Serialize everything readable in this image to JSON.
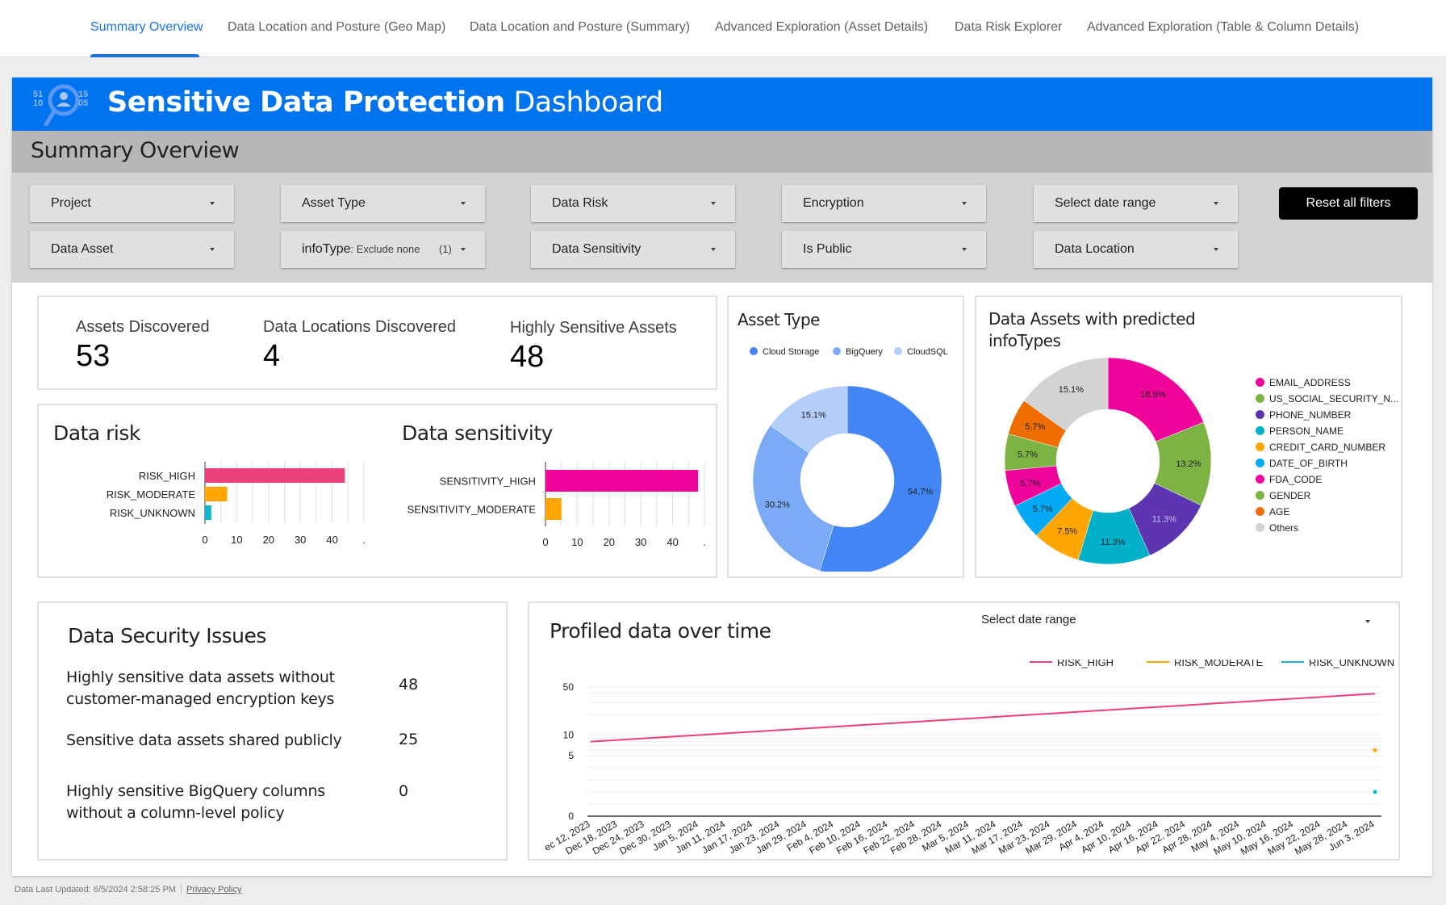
{
  "tabs": [
    {
      "label": "Summary Overview",
      "active": true
    },
    {
      "label": "Data Location and Posture (Geo Map)",
      "active": false
    },
    {
      "label": "Data Location and Posture (Summary)",
      "active": false
    },
    {
      "label": "Advanced Exploration (Asset Details)",
      "active": false
    },
    {
      "label": "Data Risk Explorer",
      "active": false
    },
    {
      "label": "Advanced Exploration (Table & Column Details)",
      "active": false
    }
  ],
  "header": {
    "title_bold": "Sensitive Data Protection",
    "title_light": " Dashboard",
    "logo_digits": [
      "51",
      "10",
      "15",
      "05"
    ],
    "subtitle": "Summary Overview",
    "accent_color": "#0073ee"
  },
  "filters": [
    {
      "label": "Project"
    },
    {
      "label": "Asset Type"
    },
    {
      "label": "Data Risk"
    },
    {
      "label": "Encryption"
    },
    {
      "label": "Select date range"
    },
    {
      "label": "Data Asset"
    },
    {
      "label": "infoType",
      "value": ": Exclude none",
      "count": "(1)"
    },
    {
      "label": "Data Sensitivity"
    },
    {
      "label": "Is Public"
    },
    {
      "label": "Data Location"
    }
  ],
  "reset_label": "Reset all filters",
  "kpis": [
    {
      "label": "Assets Discovered",
      "value": "53"
    },
    {
      "label": "Data Locations Discovered",
      "value": "4"
    },
    {
      "label": "Highly Sensitive Assets",
      "value": "48"
    }
  ],
  "security": {
    "title": "Data Security Issues",
    "items": [
      {
        "text": "Highly sensitive data assets without customer-managed encryption keys",
        "value": "48"
      },
      {
        "text": "Sensitive data assets shared publicly",
        "value": "25"
      },
      {
        "text": "Highly sensitive BigQuery columns without a column-level policy",
        "value": "0"
      }
    ]
  },
  "line_card": {
    "title": "Profiled data over time",
    "date_selector": "Select date range"
  },
  "footer": {
    "updated": "Data Last Updated: 6/5/2024 2:58:25 PM",
    "privacy": "Privacy Policy"
  },
  "chart_data": [
    {
      "id": "data_risk",
      "type": "bar",
      "orientation": "horizontal",
      "title": "Data risk",
      "categories": [
        "RISK_HIGH",
        "RISK_MODERATE",
        "RISK_UNKNOWN"
      ],
      "values": [
        44,
        7,
        2
      ],
      "colors": [
        "#ec407a",
        "#ffa600",
        "#12b5cb"
      ],
      "xticks": [
        "0",
        "10",
        "20",
        "30",
        "40",
        "."
      ],
      "xlim": [
        0,
        50
      ],
      "grid": true
    },
    {
      "id": "data_sensitivity",
      "type": "bar",
      "orientation": "horizontal",
      "title": "Data sensitivity",
      "categories": [
        "SENSITIVITY_HIGH",
        "SENSITIVITY_MODERATE"
      ],
      "values": [
        48,
        5
      ],
      "colors": [
        "#f0039a",
        "#ffa600"
      ],
      "xticks": [
        "0",
        "10",
        "20",
        "30",
        "40",
        "."
      ],
      "xlim": [
        0,
        50
      ],
      "grid": true
    },
    {
      "id": "asset_type",
      "type": "pie",
      "donut": true,
      "title": "Asset Type",
      "legend_position": "top",
      "labels": [
        "Cloud Storage",
        "BigQuery",
        "CloudSQL"
      ],
      "values": [
        54.7,
        30.2,
        15.1
      ],
      "value_labels": [
        "54.7%",
        "30.2%",
        "15.1%"
      ],
      "colors": [
        "#4285f4",
        "#7baaf7",
        "#b3cefb"
      ]
    },
    {
      "id": "infotypes",
      "type": "pie",
      "donut": true,
      "title": "Data Assets with predicted infoTypes",
      "legend_position": "right",
      "labels": [
        "EMAIL_ADDRESS",
        "US_SOCIAL_SECURITY_N...",
        "PHONE_NUMBER",
        "PERSON_NAME",
        "CREDIT_CARD_NUMBER",
        "DATE_OF_BIRTH",
        "FDA_CODE",
        "GENDER",
        "AGE",
        "Others"
      ],
      "values": [
        18.9,
        13.2,
        11.3,
        11.3,
        7.5,
        5.7,
        5.7,
        5.7,
        5.7,
        15.1
      ],
      "value_labels": [
        "18.9%",
        "13.2%",
        "11.3%",
        "11.3%",
        "7.5%",
        "5.7%",
        "5.7%",
        "5.7%",
        "5.7%",
        "15.1%"
      ],
      "colors": [
        "#f0039a",
        "#7cb342",
        "#5e35b1",
        "#00b0c8",
        "#ffa600",
        "#03a9f4",
        "#f0039a",
        "#7cb342",
        "#ef6c00",
        "#d3d3d3"
      ]
    },
    {
      "id": "profiled_over_time",
      "type": "line",
      "title": "Profiled data over time",
      "legend_position": "top-right",
      "y_scale": "log",
      "yticks": [
        "0",
        "5",
        "10",
        "50"
      ],
      "x": [
        "ec 12, 2023",
        "Dec 18, 2023",
        "Dec 24, 2023",
        "Dec 30, 2023",
        "Jan 5, 2024",
        "Jan 11, 2024",
        "Jan 17, 2024",
        "Jan 23, 2024",
        "Jan 29, 2024",
        "Feb 4, 2024",
        "Feb 10, 2024",
        "Feb 16, 2024",
        "Feb 22, 2024",
        "Feb 28, 2024",
        "Mar 5, 2024",
        "Mar 11, 2024",
        "Mar 17, 2024",
        "Mar 23, 2024",
        "Mar 29, 2024",
        "Apr 4, 2024",
        "Apr 10, 2024",
        "Apr 16, 2024",
        "Apr 22, 2024",
        "Apr 28, 2024",
        "May 4, 2024",
        "May 10, 2024",
        "May 16, 2024",
        "May 22, 2024",
        "May 28, 2024",
        "Jun 3, 2024"
      ],
      "series": [
        {
          "name": "RISK_HIGH",
          "color": "#ec407a",
          "start": 8,
          "end": 40
        },
        {
          "name": "RISK_MODERATE",
          "color": "#ffa600",
          "last_value": 6
        },
        {
          "name": "RISK_UNKNOWN",
          "color": "#12b5cb",
          "last_value": 2
        }
      ]
    }
  ]
}
